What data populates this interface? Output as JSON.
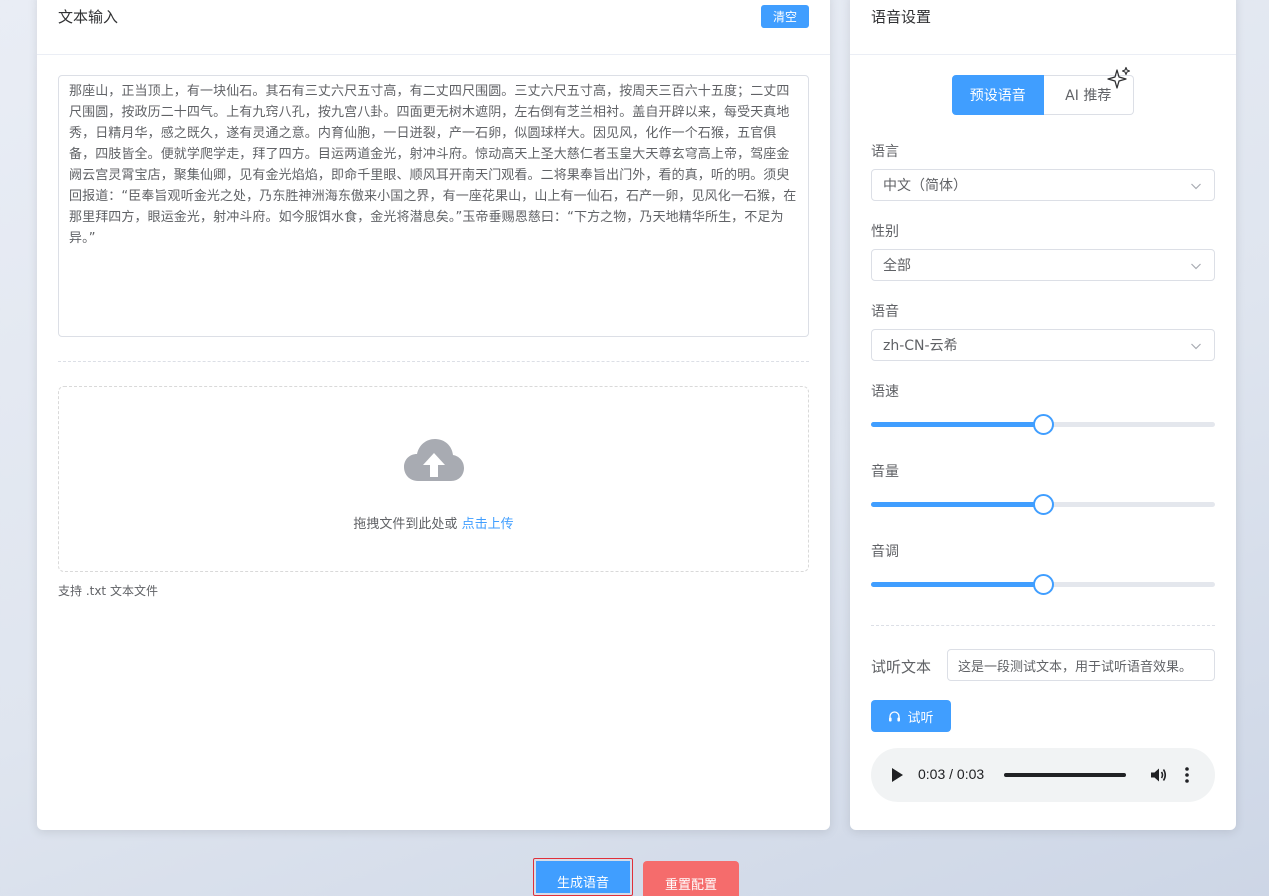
{
  "text_input": {
    "title": "文本输入",
    "clear_label": "清空",
    "content": "那座山，正当顶上，有一块仙石。其石有三丈六尺五寸高，有二丈四尺围圆。三丈六尺五寸高，按周天三百六十五度；二丈四尺围圆，按政历二十四气。上有九窍八孔，按九宫八卦。四面更无树木遮阴，左右倒有芝兰相衬。盖自开辟以来，每受天真地秀，日精月华，感之既久，遂有灵通之意。内育仙胞，一日迸裂，产一石卵，似圆球样大。因见风，化作一个石猴，五官俱备，四肢皆全。便就学爬学走，拜了四方。目运两道金光，射冲斗府。惊动高天上圣大慈仁者玉皇大天尊玄穹高上帝，驾座金阙云宫灵霄宝店，聚集仙卿，见有金光焰焰，即命千里眼、顺风耳开南天门观看。二将果奉旨出门外，看的真，听的明。须臾回报道：“臣奉旨观听金光之处，乃东胜神洲海东傲来小国之界，有一座花果山，山上有一仙石，石产一卵，见风化一石猴，在那里拜四方，眼运金光，射冲斗府。如今服饵水食，金光将潜息矣。”玉帝垂赐恩慈曰：“下方之物，乃天地精华所生，不足为异。”",
    "upload_prompt": "拖拽文件到此处或",
    "upload_link": "点击上传",
    "upload_tip": "支持 .txt 文本文件"
  },
  "voice_settings": {
    "title": "语音设置",
    "tabs": [
      {
        "label": "预设语音",
        "active": true
      },
      {
        "label": "AI 推荐",
        "active": false
      }
    ],
    "language_label": "语言",
    "language_value": "中文（简体）",
    "gender_label": "性别",
    "gender_value": "全部",
    "voice_label": "语音",
    "voice_value": "zh-CN-云希",
    "speed_label": "语速",
    "speed_fraction": 0.5,
    "volume_label": "音量",
    "volume_fraction": 0.5,
    "pitch_label": "音调",
    "pitch_fraction": 0.5,
    "preview_label": "试听文本",
    "preview_text": "这是一段测试文本，用于试听语音效果。",
    "listen_label": "试听",
    "audio_time": "0:03 / 0:03",
    "audio_progress": 1.0
  },
  "actions": {
    "generate_label": "生成语音",
    "reset_label": "重置配置"
  },
  "colors": {
    "primary": "#409eff",
    "danger": "#f56c6c"
  }
}
